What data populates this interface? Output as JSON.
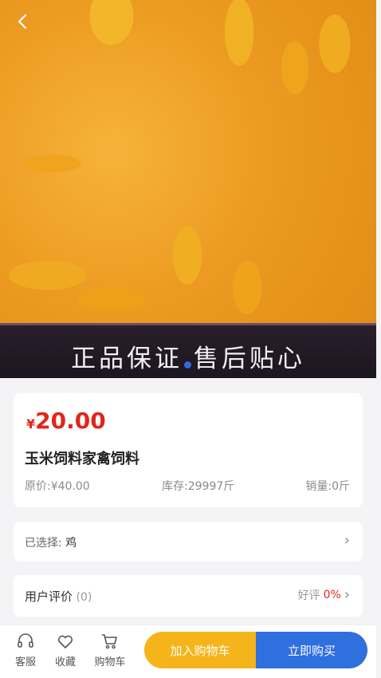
{
  "hero": {
    "banner_text": "正品保证 售后贴心",
    "slide_index": 1
  },
  "product": {
    "currency_symbol": "¥",
    "price": "20.00",
    "title": "玉米饲料家禽饲料",
    "original_price": "原价:¥40.00",
    "stock": "库存:29997斤",
    "sales": "销量:0斤"
  },
  "selection": {
    "label": "已选择:",
    "value": "鸡",
    "chevron": "›"
  },
  "review": {
    "label": "用户评价",
    "count": "(0)",
    "good_label": "好评",
    "good_pct": "0%",
    "chevron": "›"
  },
  "bottom_bar": {
    "service_label": "客服",
    "favorite_label": "收藏",
    "cart_label": "购物车",
    "add_to_cart_label": "加入购物车",
    "buy_now_label": "立即购买"
  },
  "colors": {
    "price": "#e1261c",
    "add_to_cart": "#f5b419",
    "buy_now": "#2f6fde",
    "background": "#f4f4f6"
  },
  "icons": {
    "back": "back-arrow-icon",
    "service": "headset-icon",
    "favorite": "heart-icon",
    "cart": "cart-icon"
  }
}
